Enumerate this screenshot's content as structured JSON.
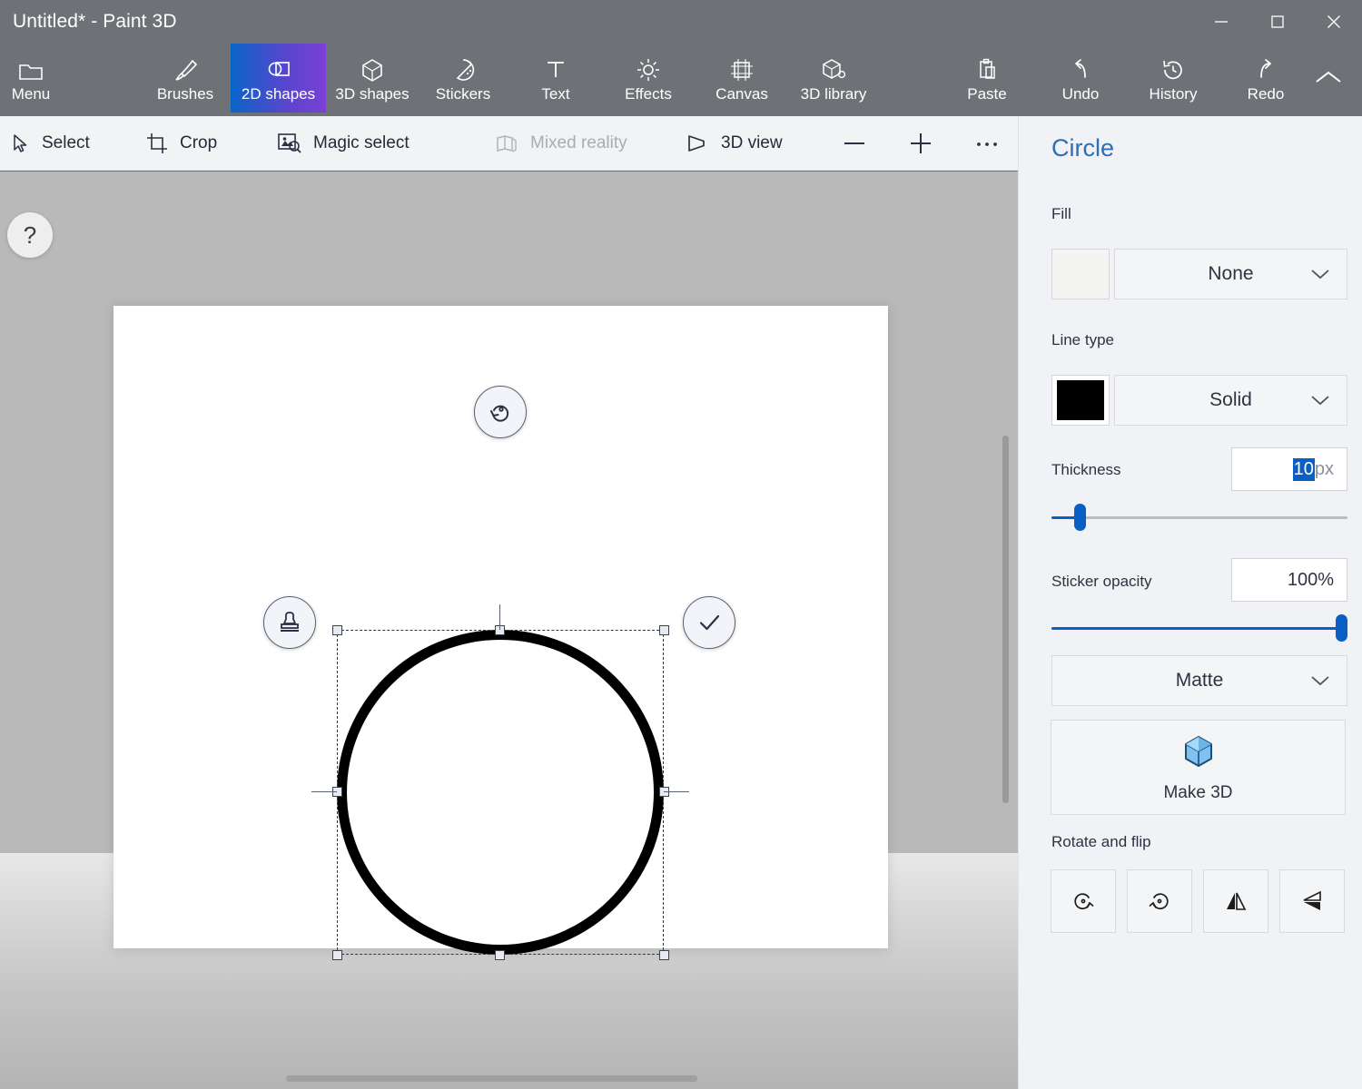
{
  "window": {
    "title": "Untitled* - Paint 3D",
    "controls": [
      {
        "name": "minimize",
        "glyph": "minimize-icon"
      },
      {
        "name": "maximize",
        "glyph": "maximize-icon"
      },
      {
        "name": "close",
        "glyph": "close-icon"
      }
    ]
  },
  "ribbon": {
    "items": [
      {
        "label": "Menu",
        "icon": "folder-icon",
        "active": false
      },
      {
        "label": "Brushes",
        "icon": "brush-icon",
        "active": false
      },
      {
        "label": "2D shapes",
        "icon": "shapes-2d-icon",
        "active": true
      },
      {
        "label": "3D shapes",
        "icon": "cube-icon",
        "active": false
      },
      {
        "label": "Stickers",
        "icon": "sticker-icon",
        "active": false
      },
      {
        "label": "Text",
        "icon": "text-icon",
        "active": false
      },
      {
        "label": "Effects",
        "icon": "effects-sun-icon",
        "active": false
      },
      {
        "label": "Canvas",
        "icon": "canvas-frame-icon",
        "active": false
      },
      {
        "label": "3D library",
        "icon": "3d-library-icon",
        "active": false
      },
      {
        "label": "Paste",
        "icon": "clipboard-icon",
        "active": false
      },
      {
        "label": "Undo",
        "icon": "undo-arrow-icon",
        "active": false
      },
      {
        "label": "History",
        "icon": "history-clock-icon",
        "active": false
      },
      {
        "label": "Redo",
        "icon": "redo-arrow-icon",
        "active": false
      }
    ],
    "collapse": "chevron-up-icon",
    "active_tab_gradient": [
      "#0a64c8",
      "#7b3fd6"
    ]
  },
  "subbar": {
    "items": [
      {
        "label": "Select",
        "icon": "cursor-arrow-icon",
        "disabled": false
      },
      {
        "label": "Crop",
        "icon": "crop-icon",
        "disabled": false
      },
      {
        "label": "Magic select",
        "icon": "magic-select-icon",
        "disabled": false
      },
      {
        "label": "Mixed reality",
        "icon": "mixed-reality-icon",
        "disabled": true
      },
      {
        "label": "3D view",
        "icon": "3d-view-icon",
        "disabled": false
      }
    ],
    "zoom_out": "minus-icon",
    "zoom_in": "plus-icon",
    "more": "ellipsis-icon"
  },
  "workspace": {
    "help_glyph": "?",
    "background_color": "#b9b9b9",
    "canvas_color": "#ffffff",
    "selection": {
      "shape": "circle",
      "stroke_color": "#000000",
      "rotate_handle": "rotate-handle-icon",
      "stamp_handle": "stamp-icon",
      "confirm_handle": "checkmark-icon"
    }
  },
  "panel": {
    "title": "Circle",
    "fill": {
      "label": "Fill",
      "value": "None",
      "swatch_color": "#f4f5f3"
    },
    "line_type": {
      "label": "Line type",
      "value": "Solid",
      "swatch_color": "#000000"
    },
    "thickness": {
      "label": "Thickness",
      "value": "10",
      "unit": "px",
      "slider_percent": 9
    },
    "opacity": {
      "label": "Sticker opacity",
      "value": "100%",
      "slider_percent": 100
    },
    "material": {
      "value": "Matte"
    },
    "make_3d": {
      "label": "Make 3D",
      "icon": "cube-3d-icon"
    },
    "rotate_and_flip": {
      "label": "Rotate and flip",
      "buttons": [
        {
          "name": "rotate-left-button",
          "icon": "rotate-left-icon"
        },
        {
          "name": "rotate-right-button",
          "icon": "rotate-right-icon"
        },
        {
          "name": "flip-horizontal-button",
          "icon": "flip-horizontal-icon"
        },
        {
          "name": "flip-vertical-button",
          "icon": "flip-vertical-icon"
        }
      ]
    },
    "accent_color": "#0b5fc4",
    "title_color": "#2a6fb8"
  }
}
